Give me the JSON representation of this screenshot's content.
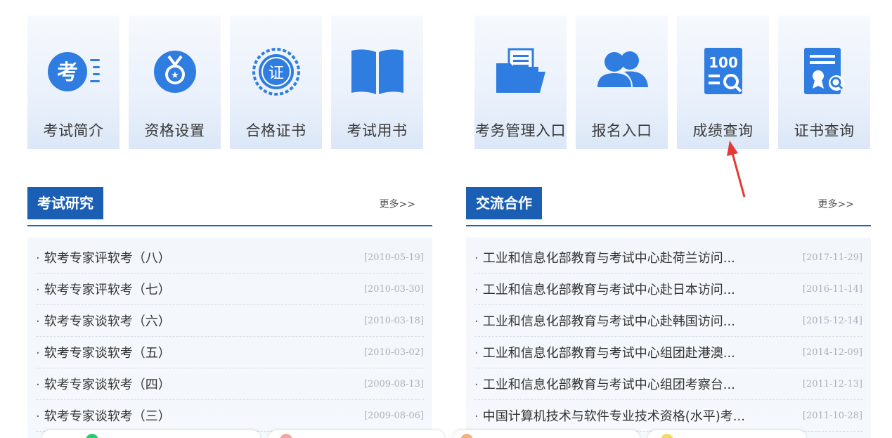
{
  "tiles_left": [
    {
      "label": "考试简介",
      "icon": "exam-badge-icon"
    },
    {
      "label": "资格设置",
      "icon": "medal-icon"
    },
    {
      "label": "合格证书",
      "icon": "certificate-seal-icon"
    },
    {
      "label": "考试用书",
      "icon": "open-book-icon"
    }
  ],
  "tiles_right": [
    {
      "label": "考务管理入口",
      "icon": "folder-document-icon"
    },
    {
      "label": "报名入口",
      "icon": "users-icon"
    },
    {
      "label": "成绩查询",
      "icon": "score-search-icon",
      "badge": "100"
    },
    {
      "label": "证书查询",
      "icon": "certificate-search-icon"
    }
  ],
  "exam_research": {
    "title": "考试研究",
    "more": "更多>>",
    "items": [
      {
        "text": "软考专家评软考（八）",
        "date": "[2010-05-19]"
      },
      {
        "text": "软考专家评软考（七）",
        "date": "[2010-03-30]"
      },
      {
        "text": "软考专家谈软考（六）",
        "date": "[2010-03-18]"
      },
      {
        "text": "软考专家谈软考（五）",
        "date": "[2010-03-02]"
      },
      {
        "text": "软考专家谈软考（四）",
        "date": "[2009-08-13]"
      },
      {
        "text": "软考专家谈软考（三）",
        "date": "[2009-08-06]"
      }
    ]
  },
  "cooperation": {
    "title": "交流合作",
    "more": "更多>>",
    "items": [
      {
        "text": "工业和信息化部教育与考试中心赴荷兰访问...",
        "date": "[2017-11-29]"
      },
      {
        "text": "工业和信息化部教育与考试中心赴日本访问...",
        "date": "[2016-11-14]"
      },
      {
        "text": "工业和信息化部教育与考试中心赴韩国访问...",
        "date": "[2015-12-14]"
      },
      {
        "text": "工业和信息化部教育与考试中心组团赴港澳...",
        "date": "[2014-12-09]"
      },
      {
        "text": "工业和信息化部教育与考试中心组团考察台...",
        "date": "[2011-12-13]"
      },
      {
        "text": "中国计算机技术与软件专业技术资格(水平)考...",
        "date": "[2011-10-28]"
      }
    ]
  },
  "colors": {
    "primary": "#1a5fb4",
    "icon_blue": "#2f7de1",
    "arrow": "#e53935"
  }
}
